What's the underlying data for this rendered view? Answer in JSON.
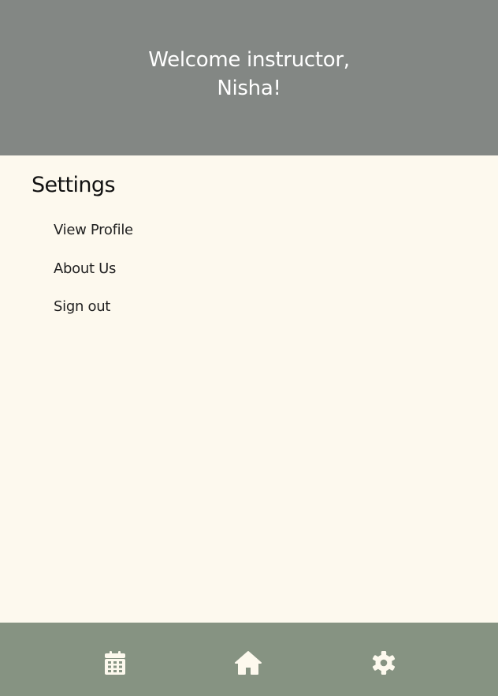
{
  "header": {
    "welcome_text": "Welcome instructor, Nisha!"
  },
  "settings": {
    "title": "Settings",
    "items": [
      {
        "label": "View Profile"
      },
      {
        "label": "About Us"
      },
      {
        "label": "Sign out"
      }
    ]
  },
  "bottom_nav": {
    "items": [
      {
        "icon": "calendar-icon"
      },
      {
        "icon": "home-icon"
      },
      {
        "icon": "gear-icon"
      }
    ]
  },
  "colors": {
    "header_bg": "#838784",
    "page_bg": "#fdf9ee",
    "footer_bg": "#869382",
    "icon": "#fdf9ee"
  }
}
